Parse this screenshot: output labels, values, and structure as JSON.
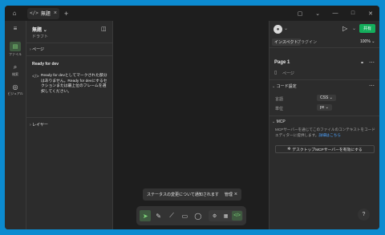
{
  "window": {
    "tab_title": "無題",
    "controls": [
      "close-tab",
      "minimize",
      "maximize",
      "close"
    ]
  },
  "rail": {
    "items": [
      {
        "label": "ファイル"
      },
      {
        "label": "検索"
      },
      {
        "label": "ビジュアル"
      }
    ]
  },
  "left_panel": {
    "doc_title": "無題",
    "doc_subtitle": "ドラフト",
    "pages_header": "ページ",
    "ready_title": "Ready for dev",
    "ready_desc": "Ready for devとしてマークされた部分はありません。Ready for devにするセクションまたは最上位のフレームを選択してください。",
    "layers_header": "レイヤー"
  },
  "toast": {
    "message": "ステータスの変更について通知されます",
    "action": "管理"
  },
  "right_panel": {
    "share_label": "共有",
    "tabs": [
      "インスペクト",
      "プラグイン"
    ],
    "zoom": "100%",
    "page_title": "Page 1",
    "page_sub": "ページ",
    "code_settings_header": "コード設定",
    "language_label": "言語",
    "language_value": "CSS",
    "unit_label": "単位",
    "unit_value": "px",
    "mcp_header": "MCP",
    "mcp_desc": "MCPサーバーを通じてこのファイルのコンテキストをコードエディターに提供します。",
    "mcp_link": "詳細はこちら",
    "mcp_button": "デスクトップMCPサーバーを有効にする"
  },
  "help_label": "?"
}
